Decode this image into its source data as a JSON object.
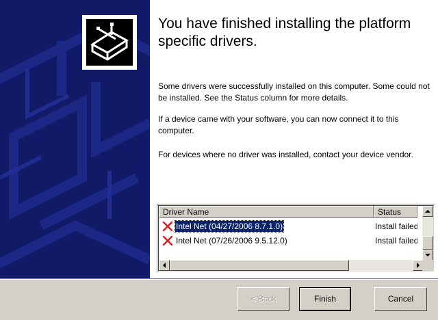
{
  "wizard": {
    "title": "You have finished installing the platform specific drivers.",
    "paragraphs": [
      "Some drivers were successfully installed on this computer. Some could not be installed. See the Status column for more details.",
      "If a device came with your software, you can now connect it to this computer.",
      "For devices where no driver was installed, contact your device vendor."
    ],
    "banner_icon": "hardware-install-icon"
  },
  "driver_list": {
    "columns": [
      "Driver Name",
      "Status"
    ],
    "rows": [
      {
        "name": "Intel Net (04/27/2006 8.7.1.0)",
        "status": "Install failed",
        "icon": "error-x-icon",
        "selected": true
      },
      {
        "name": "Intel Net (07/26/2006 9.5.12.0)",
        "status": "Install failed",
        "icon": "error-x-icon",
        "selected": false
      }
    ]
  },
  "buttons": {
    "back": "< Back",
    "finish": "Finish",
    "cancel": "Cancel"
  },
  "colors": {
    "banner": "#111a66",
    "selection": "#0a246a",
    "error_x": "#d81c1c",
    "dialog_face": "#d4d0c8"
  }
}
